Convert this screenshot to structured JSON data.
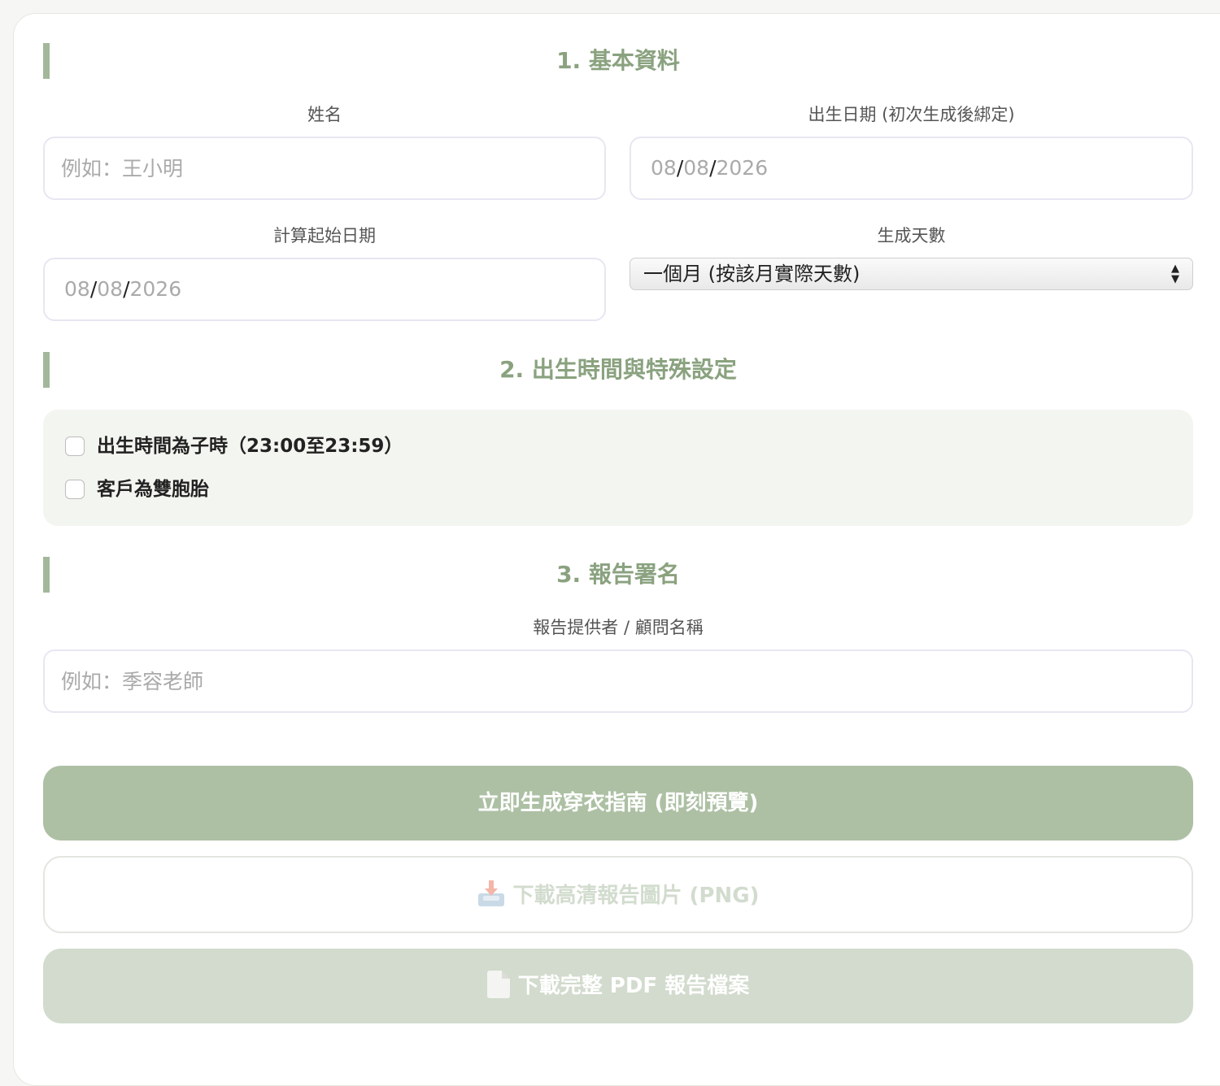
{
  "section1": {
    "title": "1. 基本資料",
    "name_label": "姓名",
    "name_placeholder": "例如：王小明",
    "birth_label": "出生日期 (初次生成後綁定)",
    "birth_date": {
      "month": "08",
      "day": "08",
      "year": "2026"
    },
    "start_label": "計算起始日期",
    "start_date": {
      "month": "08",
      "day": "08",
      "year": "2026"
    },
    "days_label": "生成天數",
    "days_selected": "一個月 (按該月實際天數)"
  },
  "section2": {
    "title": "2. 出生時間與特殊設定",
    "check_zishi": "出生時間為子時（23:00至23:59）",
    "check_twins": "客戶為雙胞胎"
  },
  "section3": {
    "title": "3. 報告署名",
    "provider_label": "報告提供者 / 顧問名稱",
    "provider_placeholder": "例如：季容老師"
  },
  "actions": {
    "generate": "立即生成穿衣指南 (即刻預覽)",
    "download_png": "下載高清報告圖片 (PNG)",
    "download_pdf": "下載完整 PDF 報告檔案"
  },
  "icons": {
    "png": "inbox-tray-icon",
    "pdf": "page-document-icon"
  },
  "colors": {
    "accent": "#8aa27f",
    "primary_button": "#adc0a4",
    "disabled_button": "#d2dbcd"
  }
}
